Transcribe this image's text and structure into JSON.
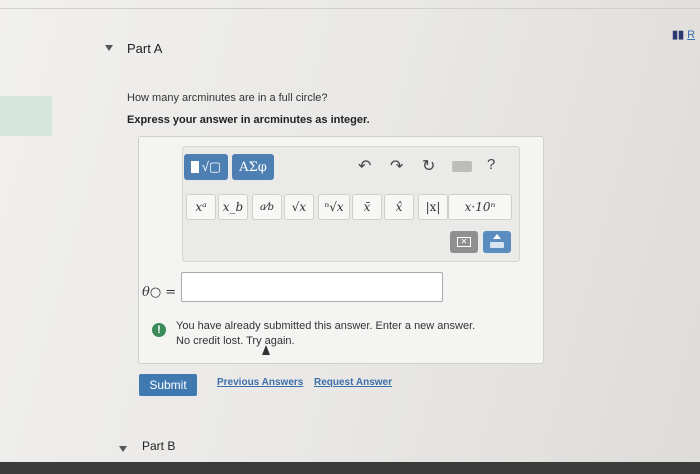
{
  "header": {
    "badge_bars": "▮▮",
    "badge_link": "R"
  },
  "parts": [
    {
      "label": "Part A"
    },
    {
      "label": "Part B"
    }
  ],
  "question": {
    "prompt": "How many arcminutes are in a full circle?",
    "instruction": "Express your answer in arcminutes as integer."
  },
  "toolbar": {
    "template_button_glyph": "√▢",
    "greek_button_label": "ΑΣφ",
    "undo_glyph": "↶",
    "redo_glyph": "↷",
    "reset_glyph": "↻",
    "help_label": "?",
    "symbols": [
      {
        "label": "xᵃ"
      },
      {
        "label": "x_b"
      },
      {
        "label": "a⁄b"
      },
      {
        "label": "√x"
      },
      {
        "label": "ⁿ√x"
      },
      {
        "label": "x̄"
      },
      {
        "label": "x̂"
      },
      {
        "label": "|x|"
      },
      {
        "label": "x·10ⁿ"
      }
    ],
    "delete_glyph": "✕"
  },
  "answer": {
    "variable_label": "θ○ =",
    "value": "",
    "placeholder": ""
  },
  "alert": {
    "icon": "!",
    "line1": "You have already submitted this answer. Enter a new answer.",
    "line2": "No credit lost. Try again."
  },
  "actions": {
    "submit_label": "Submit",
    "previous_answers_label": "Previous Answers",
    "request_answer_label": "Request Answer"
  },
  "colors": {
    "primary_blue": "#4d7fb3",
    "link_blue": "#3c6ea8",
    "alert_green": "#3a8a5a"
  }
}
